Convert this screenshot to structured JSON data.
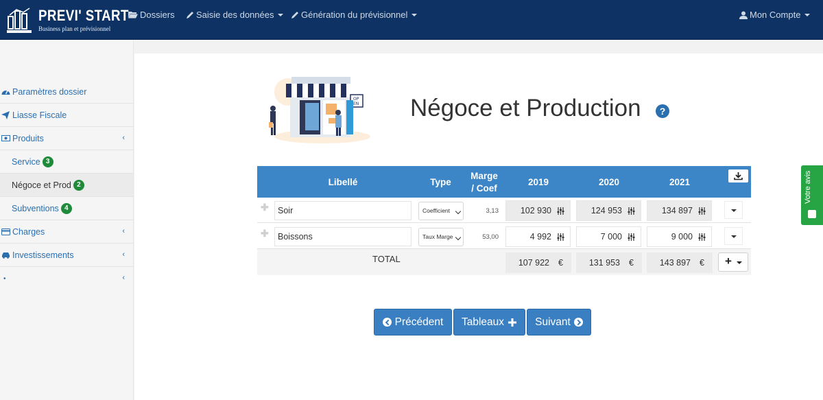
{
  "brand": {
    "name": "PREVI' START",
    "tagline": "Business plan et prévisionnel"
  },
  "nav": {
    "dossiers": "Dossiers",
    "saisie": "Saisie des données",
    "generation": "Génération du prévisionnel",
    "compte": "Mon Compte"
  },
  "sidebar": {
    "items": [
      {
        "label": "Paramètres dossier",
        "icon": "dashboard-icon"
      },
      {
        "label": "Liasse Fiscale",
        "icon": "send-icon"
      },
      {
        "label": "Produits",
        "icon": "money-icon"
      },
      {
        "label": "Service",
        "badge": "3"
      },
      {
        "label": "Négoce et Prod",
        "badge": "2"
      },
      {
        "label": "Subventions",
        "badge": "4"
      },
      {
        "label": "Charges",
        "icon": "credit-card-icon"
      },
      {
        "label": "Investissements",
        "icon": "car-icon"
      },
      {
        "label": "•"
      }
    ]
  },
  "page": {
    "title": "Négoce et Production",
    "help": "?"
  },
  "table": {
    "headers": {
      "libelle": "Libellé",
      "type": "Type",
      "marge1": "Marge",
      "marge2": "/ Coef",
      "y2019": "2019",
      "y2020": "2020",
      "y2021": "2021"
    },
    "rows": [
      {
        "libelle": "Soir",
        "type": "Coefficient",
        "marge": "3,13",
        "v2019": "102 930",
        "v2020": "124 953",
        "v2021": "134 897"
      },
      {
        "libelle": "Boissons",
        "type": "Taux Marge",
        "marge": "53,00",
        "v2019": "4 992",
        "v2020": "7 000",
        "v2021": "9 000"
      }
    ],
    "total": {
      "label": "TOTAL",
      "v2019": "107 922",
      "v2020": "131 953",
      "v2021": "143 897",
      "currency": "€"
    }
  },
  "buttons": {
    "precedent": "Précédent",
    "tableaux": "Tableaux",
    "suivant": "Suivant"
  },
  "feedback": {
    "label": "Votre avis"
  },
  "colors": {
    "navbar": "#0d3263",
    "accent": "#3c85c6",
    "badge": "#1e8a3a",
    "feedback": "#27a544"
  }
}
